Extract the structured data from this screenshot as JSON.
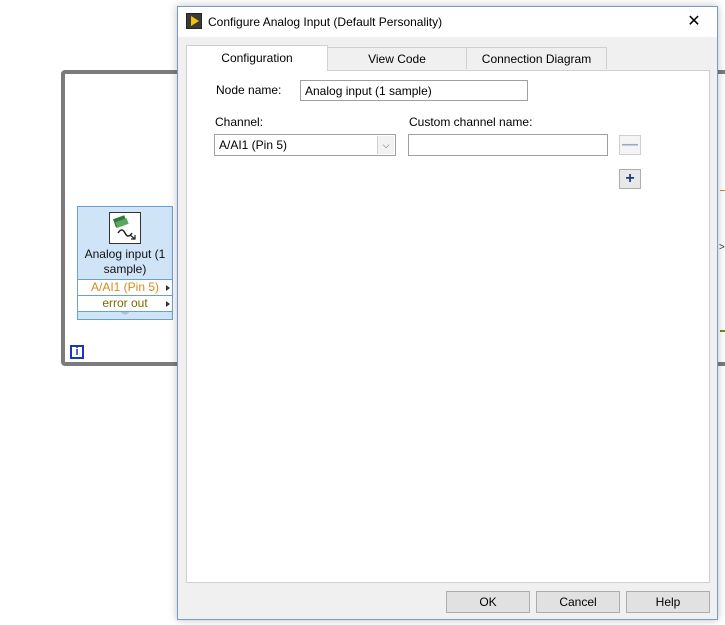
{
  "block_diagram": {
    "iteration_label": "i",
    "node": {
      "title": "Analog input (1 sample)",
      "terminals": [
        "A/AI1 (Pin 5)",
        "error out"
      ]
    }
  },
  "dialog": {
    "title": "Configure Analog Input (Default Personality)",
    "close_symbol": "✕",
    "tabs": [
      {
        "label": "Configuration"
      },
      {
        "label": "View Code"
      },
      {
        "label": "Connection Diagram"
      }
    ],
    "form": {
      "node_name_label": "Node name:",
      "node_name_value": "Analog input (1 sample)",
      "channel_label": "Channel:",
      "channel_value": "A/AI1 (Pin 5)",
      "custom_channel_label": "Custom channel name:",
      "custom_channel_value": "",
      "remove_symbol": "—",
      "add_symbol": "+"
    },
    "buttons": {
      "ok": "OK",
      "cancel": "Cancel",
      "help": "Help"
    }
  }
}
